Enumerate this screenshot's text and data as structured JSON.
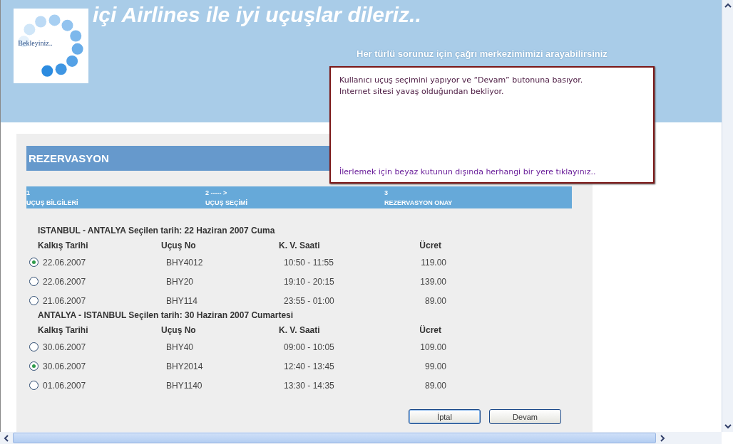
{
  "header": {
    "title": "içi Airlines ile iyi uçuşlar dileriz..",
    "subtitle": "Her türlü sorunuz için çağrı merkezimimizi arayabilirsiniz",
    "logo_text": "Bekleyiniz.."
  },
  "popup": {
    "lines": [
      "Kullanıcı uçuş seçimini yapıyor ve “Devam” butonuna basıyor.",
      "Internet sitesi yavaş olduğundan bekliyor."
    ],
    "link": "İlerlemek için beyaz kutunun dışında herhangi bir yere tıklayınız.."
  },
  "reservation": {
    "title": "REZERVASYON",
    "steps": [
      {
        "number": "1",
        "label": "UÇUŞ BİLGİLERİ"
      },
      {
        "number": "2 ----- >",
        "label": "UÇUŞ SEÇİMİ"
      },
      {
        "number": "3",
        "label": "REZERVASYON ONAY"
      }
    ],
    "legs": [
      {
        "heading": "ISTANBUL - ANTALYA Seçilen tarih: 22 Haziran 2007 Cuma",
        "columns": [
          "Kalkış Tarihi",
          "Uçuş No",
          "K. V. Saati",
          "Ücret"
        ],
        "flights": [
          {
            "selected": true,
            "date": "22.06.2007",
            "flight": "BHY4012",
            "time": "10:50 - 11:55",
            "price": "119.00"
          },
          {
            "selected": false,
            "date": "22.06.2007",
            "flight": "BHY20",
            "time": "19:10 - 20:15",
            "price": "139.00"
          },
          {
            "selected": false,
            "date": "21.06.2007",
            "flight": "BHY114",
            "time": "23:55 - 01:00",
            "price": "89.00"
          }
        ]
      },
      {
        "heading": "ANTALYA - ISTANBUL Seçilen tarih: 30 Haziran 2007 Cumartesi",
        "columns": [
          "Kalkış Tarihi",
          "Uçuş No",
          "K. V. Saati",
          "Ücret"
        ],
        "flights": [
          {
            "selected": false,
            "date": "30.06.2007",
            "flight": "BHY40",
            "time": "09:00 - 10:05",
            "price": "109.00"
          },
          {
            "selected": true,
            "date": "30.06.2007",
            "flight": "BHY2014",
            "time": "12:40 - 13:45",
            "price": "99.00"
          },
          {
            "selected": false,
            "date": "01.06.2007",
            "flight": "BHY1140",
            "time": "13:30 - 14:35",
            "price": "89.00"
          }
        ]
      }
    ]
  },
  "buttons": [
    "İptal",
    "Devam"
  ]
}
